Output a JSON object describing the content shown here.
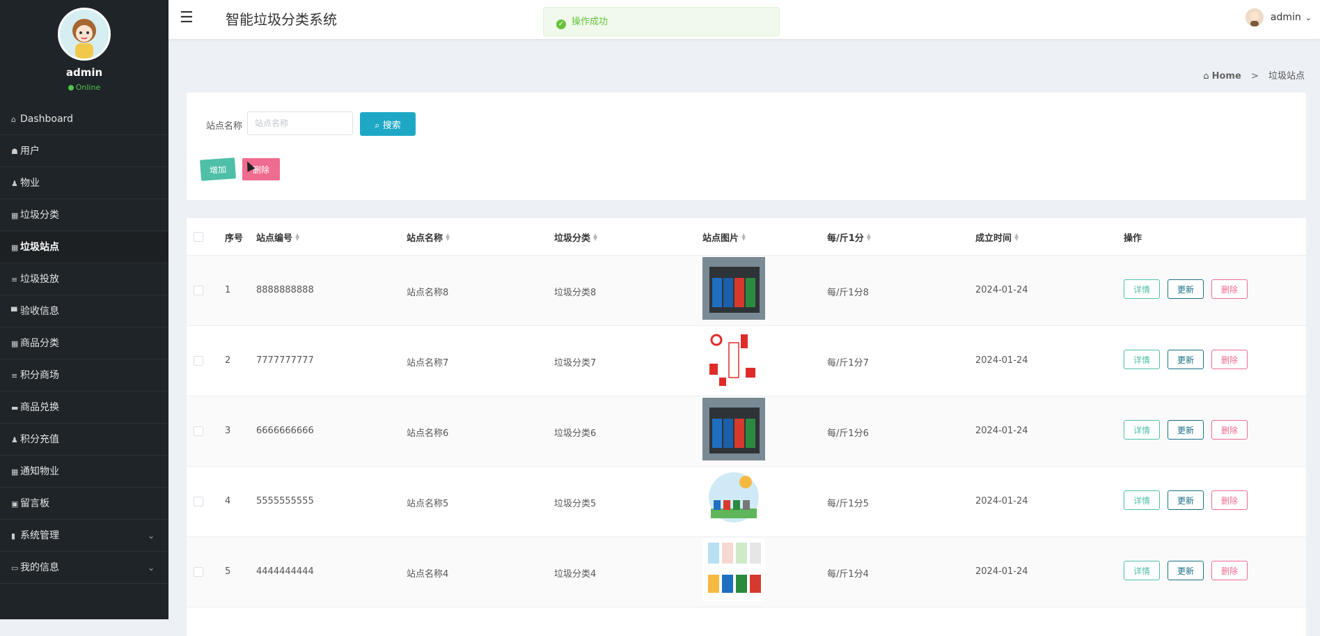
{
  "sidebar": {
    "username": "admin",
    "status": "Online",
    "items": [
      {
        "label": "Dashboard",
        "icon": "home-icon",
        "glyph": "⌂"
      },
      {
        "label": "用户",
        "icon": "bag-icon",
        "glyph": "☗"
      },
      {
        "label": "物业",
        "icon": "person-icon",
        "glyph": "♟"
      },
      {
        "label": "垃圾分类",
        "icon": "grid-icon",
        "glyph": "▦"
      },
      {
        "label": "垃圾站点",
        "icon": "grid-icon",
        "glyph": "▦"
      },
      {
        "label": "垃圾投放",
        "icon": "list-icon",
        "glyph": "≡"
      },
      {
        "label": "验收信息",
        "icon": "monitor-icon",
        "glyph": "▀"
      },
      {
        "label": "商品分类",
        "icon": "grid-icon",
        "glyph": "▦"
      },
      {
        "label": "积分商场",
        "icon": "list-icon",
        "glyph": "≡"
      },
      {
        "label": "商品兑换",
        "icon": "ticket-icon",
        "glyph": "▬"
      },
      {
        "label": "积分充值",
        "icon": "person-icon",
        "glyph": "♟"
      },
      {
        "label": "通知物业",
        "icon": "grid-icon",
        "glyph": "▦"
      },
      {
        "label": "留言板",
        "icon": "board-icon",
        "glyph": "▣"
      },
      {
        "label": "系统管理",
        "icon": "bar-chart-icon",
        "glyph": "▮"
      },
      {
        "label": "我的信息",
        "icon": "calendar-icon",
        "glyph": "▭"
      }
    ]
  },
  "header": {
    "title": "智能垃圾分类系统",
    "user": "admin",
    "toast": "操作成功"
  },
  "breadcrumb": {
    "home": "Home",
    "current": "垃圾站点"
  },
  "search": {
    "label": "站点名称",
    "placeholder": "站点名称",
    "button": "搜索",
    "add": "增加",
    "delete": "删除"
  },
  "table": {
    "headers": [
      "序号",
      "站点编号",
      "站点名称",
      "垃圾分类",
      "站点图片",
      "每/斤1分",
      "成立时间",
      "操作"
    ],
    "actions": {
      "detail": "详情",
      "update": "更新",
      "delete": "删除"
    },
    "rows": [
      {
        "no": "1",
        "code": "8888888888",
        "name": "站点名称8",
        "category": "垃圾分类8",
        "price": "每/斤1分8",
        "date": "2024-01-24"
      },
      {
        "no": "2",
        "code": "7777777777",
        "name": "站点名称7",
        "category": "垃圾分类7",
        "price": "每/斤1分7",
        "date": "2024-01-24"
      },
      {
        "no": "3",
        "code": "6666666666",
        "name": "站点名称6",
        "category": "垃圾分类6",
        "price": "每/斤1分6",
        "date": "2024-01-24"
      },
      {
        "no": "4",
        "code": "5555555555",
        "name": "站点名称5",
        "category": "垃圾分类5",
        "price": "每/斤1分5",
        "date": "2024-01-24"
      },
      {
        "no": "5",
        "code": "4444444444",
        "name": "站点名称4",
        "category": "垃圾分类4",
        "price": "每/斤1分4",
        "date": "2024-01-24"
      }
    ]
  },
  "colors": {
    "sidebar_bg": "#1f2428",
    "primary": "#1fa8c6",
    "success": "#4fbfa8",
    "danger": "#ef6b8f"
  }
}
